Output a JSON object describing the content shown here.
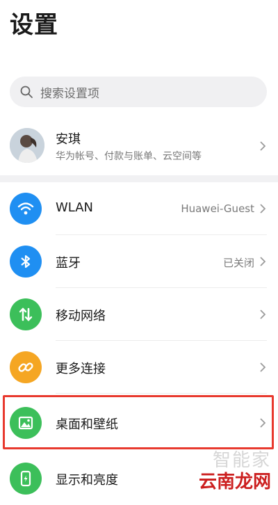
{
  "header": {
    "title": "设置"
  },
  "search": {
    "placeholder": "搜索设置项"
  },
  "account": {
    "name": "安琪",
    "subtitle": "华为帐号、付款与账单、云空间等"
  },
  "settings": [
    {
      "label": "WLAN",
      "value": "Huawei-Guest",
      "icon": "wifi-icon",
      "color": "#1f8ff2"
    },
    {
      "label": "蓝牙",
      "value": "已关闭",
      "icon": "bluetooth-icon",
      "color": "#1f8ff2"
    },
    {
      "label": "移动网络",
      "value": "",
      "icon": "mobile-network-icon",
      "color": "#3cbf5a"
    },
    {
      "label": "更多连接",
      "value": "",
      "icon": "link-icon",
      "color": "#f5a623"
    },
    {
      "label": "桌面和壁纸",
      "value": "",
      "icon": "wallpaper-icon",
      "color": "#3cbf5a"
    },
    {
      "label": "显示和亮度",
      "value": "",
      "icon": "display-icon",
      "color": "#3cbf5a"
    }
  ],
  "highlight_color": "#e8392e",
  "watermark": {
    "top": "智能家",
    "bottom": "云南龙网"
  }
}
